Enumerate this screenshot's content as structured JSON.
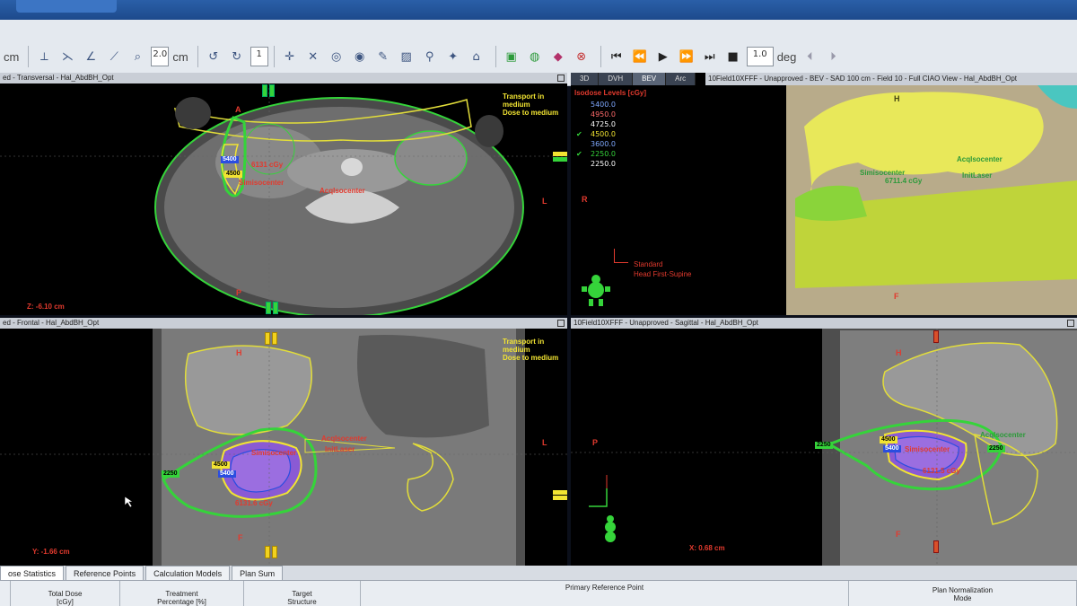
{
  "toolbar": {
    "unit1": "cm",
    "box_step": "2.0",
    "unit2": "cm",
    "box_count": "1",
    "box_angle": "1.0",
    "unit_angle": "deg"
  },
  "transversal": {
    "title": "ed - Transversal - Hal_AbdBH_Opt",
    "note": [
      "Transport in",
      "medium",
      "Dose to medium"
    ],
    "label_a": "A",
    "label_p": "P",
    "label_l": "L",
    "label_r": "R",
    "coord": "Z: -6.10 cm",
    "iso_5400": "5400",
    "iso_4500": "4500",
    "dose_label": "6131 cGy",
    "point1": "Simisocenter",
    "point2": "AcqIsocenter"
  },
  "bev": {
    "tabs": [
      "3D",
      "DVH",
      "BEV",
      "Arc"
    ],
    "title": "10Field10XFFF - Unapproved - BEV - SAD 100 cm - Field 10 - Full CIAO View - Hal_AbdBH_Opt",
    "iso_title": "Isodose Levels [cGy]",
    "iso_levels": [
      {
        "value": "5400.0",
        "checked": false,
        "color": "#7fa8ff"
      },
      {
        "value": "4950.0",
        "checked": false,
        "color": "#ff6b6b"
      },
      {
        "value": "4725.0",
        "checked": false,
        "color": "#ffffff"
      },
      {
        "value": "4500.0",
        "checked": true,
        "color": "#f2e432"
      },
      {
        "value": "3600.0",
        "checked": false,
        "color": "#7fa8ff"
      },
      {
        "value": "2250.0",
        "checked": true,
        "color": "#35d43a"
      },
      {
        "value": "2250.0",
        "checked": false,
        "color": "#ffffff"
      }
    ],
    "orientation": [
      "Standard",
      "Head First-Supine"
    ],
    "label_h": "H",
    "label_f": "F",
    "point1": "AcqIsocenter",
    "point2": "InitLaser",
    "point3": "Simisocenter",
    "dose_label": "6711.4 cGy"
  },
  "frontal": {
    "title": "ed - Frontal - Hal_AbdBH_Opt",
    "note": [
      "Transport in",
      "medium",
      "Dose to medium"
    ],
    "label_h": "H",
    "label_f": "F",
    "label_l": "L",
    "coord": "Y: -1.66 cm",
    "iso_4500": "4500",
    "iso_5400": "5400",
    "iso_2250": "2250",
    "dose_label": "6131.6 cGy",
    "point1": "Simisocenter",
    "point2": "AcqIsocenter",
    "point3": "InitLaser"
  },
  "sagittal": {
    "title": "10Field10XFFF - Unapproved - Sagittal - Hal_AbdBH_Opt",
    "label_p": "P",
    "label_h": "H",
    "label_f": "F",
    "coord": "X: 0.68 cm",
    "iso_4500": "4500",
    "iso_5400": "5400",
    "iso_2250a": "2250",
    "iso_2250b": "2250",
    "dose_label": "6131.5 cGy",
    "point1": "AcqIsocenter",
    "point2": "Simisocenter"
  },
  "bottom": {
    "tabs": [
      "ose Statistics",
      "Reference Points",
      "Calculation Models",
      "Plan Sum"
    ],
    "cols": {
      "total_dose": "Total Dose",
      "total_dose_unit": "[cGy]",
      "treatment": "Treatment",
      "percentage": "Percentage [%]",
      "target": "Target",
      "structure": "Structure",
      "primary": "Primary Reference Point",
      "normalization": "Plan Normalization",
      "mode": "Mode"
    }
  }
}
